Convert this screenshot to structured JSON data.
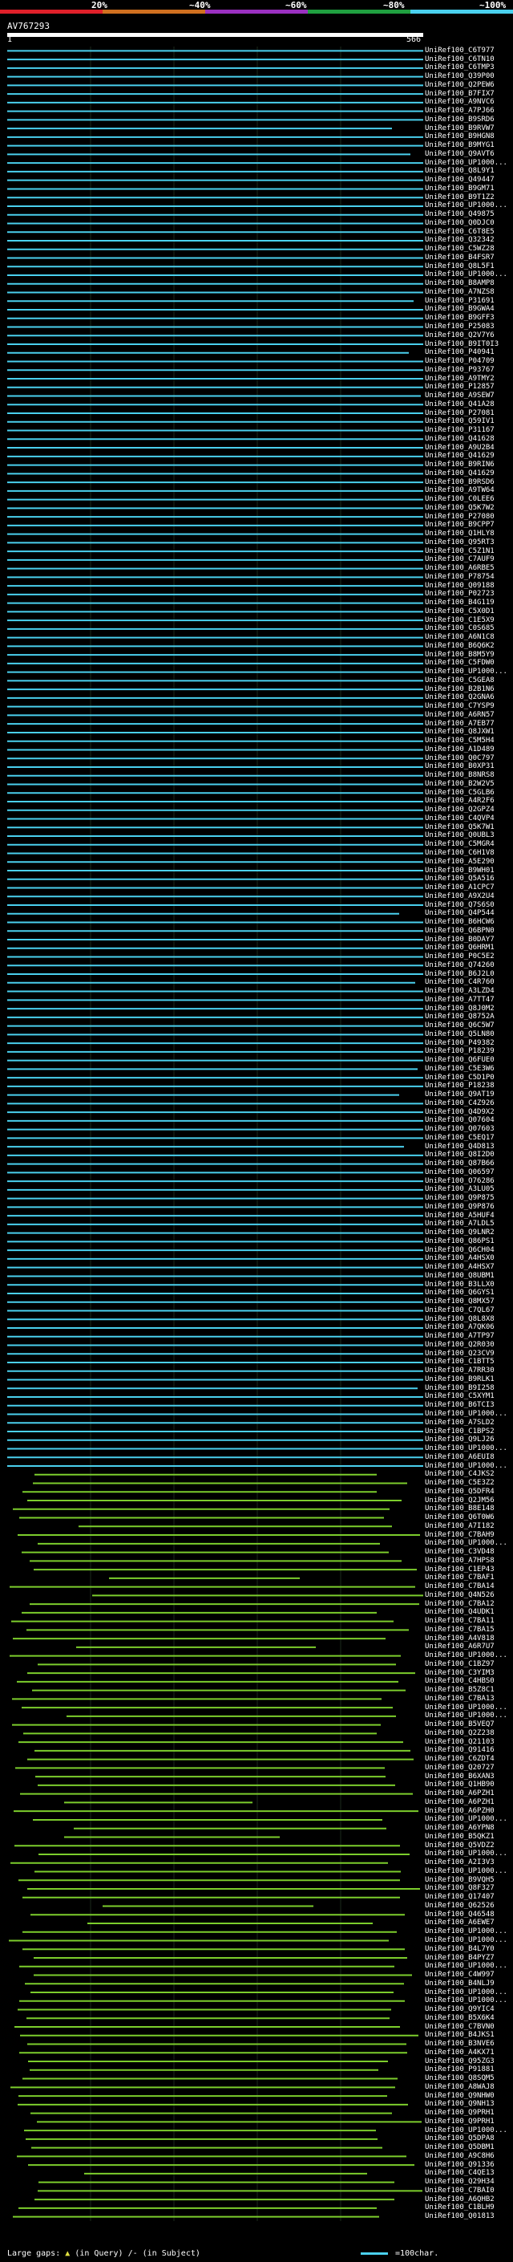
{
  "scale": {
    "labels": [
      "20%",
      "~40%",
      "~60%",
      "~80%",
      "~100%"
    ],
    "colors": [
      "#e0202a",
      "#d07020",
      "#9a30c0",
      "#20a040",
      "#4ad0ee"
    ]
  },
  "query": {
    "title": "AV767293",
    "start": "1",
    "end": "566"
  },
  "colors": {
    "cyan": "#4ad0ee",
    "green": "#7ccd2c",
    "magenta": "#e040e0",
    "dark": "#0a0a0a"
  },
  "hits": [
    "UniRef100_C6T977",
    "UniRef100_C6TN10",
    "UniRef100_C6TMP3",
    "UniRef100_Q39P00",
    "UniRef100_Q2PEW6",
    "UniRef100_B7FIX7",
    "UniRef100_A9NVC6",
    "UniRef100_A7PJ66",
    "UniRef100_B9SRD6",
    "UniRef100_B9RVW7",
    "UniRef100_B9HGN8",
    "UniRef100_B9MYG1",
    "UniRef100_Q9AVT6",
    "UniRef100_UP1000...",
    "UniRef100_Q8L9Y1",
    "UniRef100_Q49447",
    "UniRef100_B9GM71",
    "UniRef100_B9T1Z2",
    "UniRef100_UP1000...",
    "UniRef100_Q49875",
    "UniRef100_Q0DJC0",
    "UniRef100_C6T8E5",
    "UniRef100_Q32342",
    "UniRef100_C5WZ28",
    "UniRef100_B4FSR7",
    "UniRef100_Q8L5F1",
    "UniRef100_UP1000...",
    "UniRef100_B8AMP8",
    "UniRef100_A7NZS8",
    "UniRef100_P31691",
    "UniRef100_B9GWA4",
    "UniRef100_B9GFF3",
    "UniRef100_P25083",
    "UniRef100_Q2V7Y6",
    "UniRef100_B9IT0I3",
    "UniRef100_P40941",
    "UniRef100_P04709",
    "UniRef100_P93767",
    "UniRef100_A9TMY2",
    "UniRef100_P12857",
    "UniRef100_A9SEW7",
    "UniRef100_Q41A28",
    "UniRef100_P27081",
    "UniRef100_Q59IV1",
    "UniRef100_P31167",
    "UniRef100_Q41628",
    "UniRef100_A9U2B4",
    "UniRef100_Q41629",
    "UniRef100_B9RIN6",
    "UniRef100_Q41629",
    "UniRef100_B9RSD6",
    "UniRef100_A9TW64",
    "UniRef100_C0LEE6",
    "UniRef100_Q5K7W2",
    "UniRef100_P27080",
    "UniRef100_B9CPP7",
    "UniRef100_Q1HLY8",
    "UniRef100_Q95RT3",
    "UniRef100_C5Z1N1",
    "UniRef100_C7AUF9",
    "UniRef100_A6RBE5",
    "UniRef100_P78754",
    "UniRef100_Q09188",
    "UniRef100_P02723",
    "UniRef100_B4G119",
    "UniRef100_C5X0D1",
    "UniRef100_C1E5X9",
    "UniRef100_C0S685",
    "UniRef100_A6N1C8",
    "UniRef100_B6Q6K2",
    "UniRef100_B8M5Y9",
    "UniRef100_C5FDW0",
    "UniRef100_UP1000...",
    "UniRef100_C5GEA8",
    "UniRef100_B2B1N6",
    "UniRef100_Q2GNA6",
    "UniRef100_C7YSP9",
    "UniRef100_A6RN57",
    "UniRef100_A7EB77",
    "UniRef100_Q8JXW1",
    "UniRef100_C5M5H4",
    "UniRef100_A1D489",
    "UniRef100_Q0C797",
    "UniRef100_B0XP31",
    "UniRef100_B8NRS8",
    "UniRef100_B2W2V5",
    "UniRef100_C5GLB6",
    "UniRef100_A4R2F6",
    "UniRef100_Q2GPZ4",
    "UniRef100_C4QVP4",
    "UniRef100_Q5K7W1",
    "UniRef100_Q0UBL3",
    "UniRef100_C5MGR4",
    "UniRef100_C6H1V8",
    "UniRef100_A5E290",
    "UniRef100_B9WH01",
    "UniRef100_Q5A516",
    "UniRef100_A1CPC7",
    "UniRef100_A9X2U4",
    "UniRef100_Q7S6S0",
    "UniRef100_Q4P544",
    "UniRef100_B6HCW6",
    "UniRef100_Q6BPN0",
    "UniRef100_B0DAY7",
    "UniRef100_Q6HRM1",
    "UniRef100_P0C5E2",
    "UniRef100_Q74260",
    "UniRef100_B6J2L0",
    "UniRef100_C4R760",
    "UniRef100_A3LZD4",
    "UniRef100_A7TT47",
    "UniRef100_Q8J0M2",
    "UniRef100_Q8752A",
    "UniRef100_Q6C5W7",
    "UniRef100_Q5LN80",
    "UniRef100_P49382",
    "UniRef100_P18239",
    "UniRef100_Q6FUE0",
    "UniRef100_C5E3W6",
    "UniRef100_C5D1P0",
    "UniRef100_P18238",
    "UniRef100_Q9AT19",
    "UniRef100_C4Z926",
    "UniRef100_Q4D9X2",
    "UniRef100_Q07604",
    "UniRef100_Q07603",
    "UniRef100_C5EQ17",
    "UniRef100_Q4D813",
    "UniRef100_Q8I2D0",
    "UniRef100_Q87B66",
    "UniRef100_Q06597",
    "UniRef100_O76286",
    "UniRef100_A3LU05",
    "UniRef100_Q9P875",
    "UniRef100_Q9P876",
    "UniRef100_A5HUF4",
    "UniRef100_A7LDL5",
    "UniRef100_Q9LNR2",
    "UniRef100_Q86PS1",
    "UniRef100_Q6CH04",
    "UniRef100_A4HSX0",
    "UniRef100_A4HSX7",
    "UniRef100_Q8UBM1",
    "UniRef100_B3LLX0",
    "UniRef100_Q6GYS1",
    "UniRef100_Q8MX57",
    "UniRef100_C7QL67",
    "UniRef100_Q8L8X8",
    "UniRef100_A7QK06",
    "UniRef100_A7TP97",
    "UniRef100_Q2R030",
    "UniRef100_Q23CV9",
    "UniRef100_C1BTT5",
    "UniRef100_A7RR30",
    "UniRef100_B9RLK1",
    "UniRef100_B9I258",
    "UniRef100_C5XYM1",
    "UniRef100_B6TCI3",
    "UniRef100_UP1000...",
    "UniRef100_A7SLD2",
    "UniRef100_C1BPS2",
    "UniRef100_Q9LJ26",
    "UniRef100_UP1000...",
    "UniRef100_A6EUI8",
    "UniRef100_UP1000...",
    "UniRef100_C4JKS2",
    "UniRef100_C5E3Z2",
    "UniRef100_Q5DFR4",
    "UniRef100_Q2JM56",
    "UniRef100_B8E148",
    "UniRef100_Q6T0W6",
    "UniRef100_A7I182",
    "UniRef100_C7BAH9",
    "UniRef100_UP1000...",
    "UniRef100_C3VD48",
    "UniRef100_A7HPS8",
    "UniRef100_C1EP43",
    "UniRef100_C7BAF1",
    "UniRef100_C7BA14",
    "UniRef100_Q4N526",
    "UniRef100_C7BA12",
    "UniRef100_Q4UDK1",
    "UniRef100_C7BA11",
    "UniRef100_C7BA15",
    "UniRef100_A4V818",
    "UniRef100_A6R7U7",
    "UniRef100_UP1000...",
    "UniRef100_C1BZ97",
    "UniRef100_C3YIM3",
    "UniRef100_C4HBS0",
    "UniRef100_B5Z8C1",
    "UniRef100_C7BA13",
    "UniRef100_UP1000...",
    "UniRef100_UP1000...",
    "UniRef100_B5VEQ7",
    "UniRef100_Q2Z238",
    "UniRef100_Q21103",
    "UniRef100_Q91416",
    "UniRef100_C6ZDT4",
    "UniRef100_Q20727",
    "UniRef100_B6XAN3",
    "UniRef100_Q1HB90",
    "UniRef100_A6PZH1",
    "UniRef100_A6PZH1",
    "UniRef100_A6PZH0",
    "UniRef100_UP1000...",
    "UniRef100_A6YPN8",
    "UniRef100_B5QKZ1",
    "UniRef100_Q5VDZ2",
    "UniRef100_UP1000...",
    "UniRef100_A2I3V3",
    "UniRef100_UP1000...",
    "UniRef100_B9VQH5",
    "UniRef100_Q8F327",
    "UniRef100_Q17407",
    "UniRef100_Q62526",
    "UniRef100_Q46548",
    "UniRef100_A6EWE7",
    "UniRef100_UP1000...",
    "UniRef100_UP1000...",
    "UniRef100_B4L7Y0",
    "UniRef100_B4PYZ7",
    "UniRef100_UP1000...",
    "UniRef100_C4W997",
    "UniRef100_B4NLJ9",
    "UniRef100_UP1000...",
    "UniRef100_UP1000...",
    "UniRef100_Q9YIC4",
    "UniRef100_B5X6K4",
    "UniRef100_C7BVN0",
    "UniRef100_B4JKS1",
    "UniRef100_B3NVE6",
    "UniRef100_A4KX71",
    "UniRef100_Q95ZG3",
    "UniRef100_P91881",
    "UniRef100_Q8SQM5",
    "UniRef100_A8WAJ8",
    "UniRef100_Q9NHW0",
    "UniRef100_Q9NH13",
    "UniRef100_Q9PRH1",
    "UniRef100_Q9PRH1",
    "UniRef100_UP1000...",
    "UniRef100_Q5DPA8",
    "UniRef100_Q5DBM1",
    "UniRef100_A9C8H6",
    "UniRef100_Q91336",
    "UniRef100_C4QE13",
    "UniRef100_Q29H34",
    "UniRef100_C7BAI0",
    "UniRef100_A6QHB2",
    "UniRef100_C1BLH9",
    "UniRef100_Q01813"
  ],
  "legend": {
    "gaps_label": "Large gaps:",
    "query_gap": "(in Query)",
    "subject_gap": "/- (in Subject)",
    "right_label": "=100char."
  }
}
